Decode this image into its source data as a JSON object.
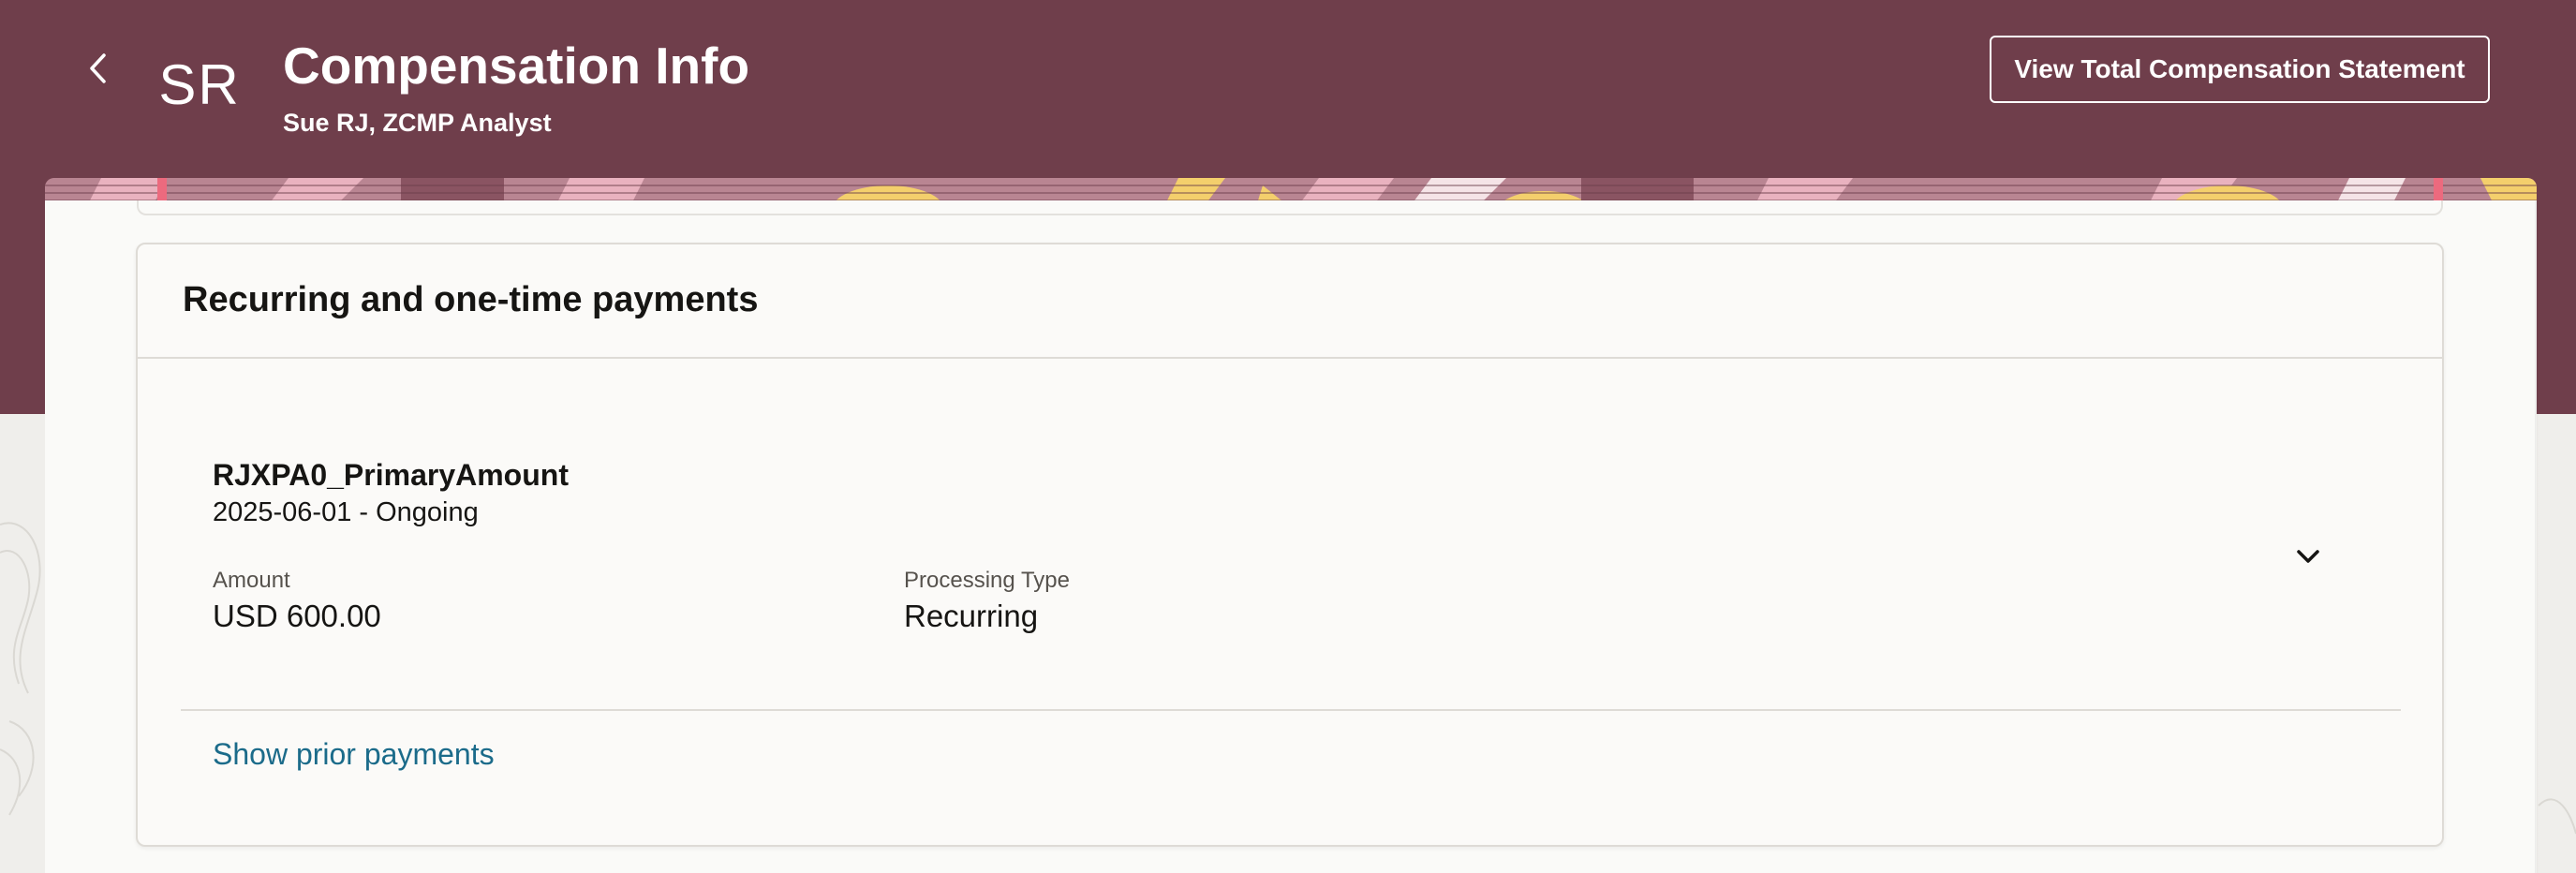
{
  "header": {
    "avatar_initials": "SR",
    "title": "Compensation Info",
    "subtitle": "Sue RJ, ZCMP Analyst",
    "action_label": "View Total Compensation Statement"
  },
  "section": {
    "title": "Recurring and one-time payments",
    "items": [
      {
        "name": "RJXPA0_PrimaryAmount",
        "dates": "2025-06-01 - Ongoing",
        "amount_label": "Amount",
        "amount_value": "USD 600.00",
        "processing_label": "Processing Type",
        "processing_value": "Recurring"
      }
    ],
    "prior_link": "Show prior payments"
  },
  "icons": {
    "back": "chevron-left-icon",
    "expand": "chevron-down-icon"
  },
  "colors": {
    "header_bg": "#6f3e4b",
    "link": "#1b6b8a",
    "banner_yellow": "#f2cf6a",
    "banner_pink": "#e4a5b4"
  }
}
